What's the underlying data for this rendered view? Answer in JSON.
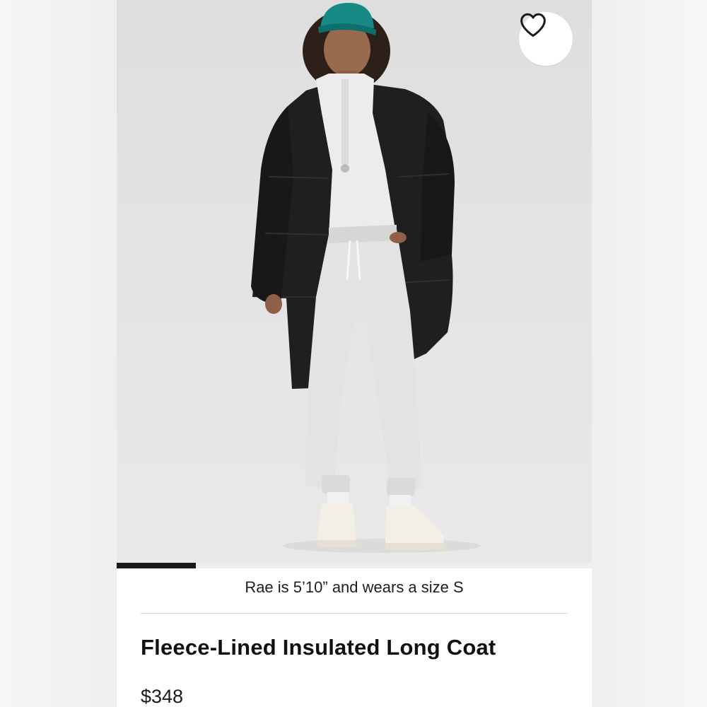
{
  "product": {
    "model_caption": "Rae is 5’10” and wears a size S",
    "title": "Fleece-Lined Insulated Long Coat",
    "price": "$348"
  },
  "gallery": {
    "image_index_fraction": 0.1667
  },
  "favorite": {
    "icon": "heart-outline-icon"
  },
  "colors": {
    "progress": "#1a1a1a",
    "background": "#ffffff",
    "photo_backdrop": "#e2e2e2"
  }
}
